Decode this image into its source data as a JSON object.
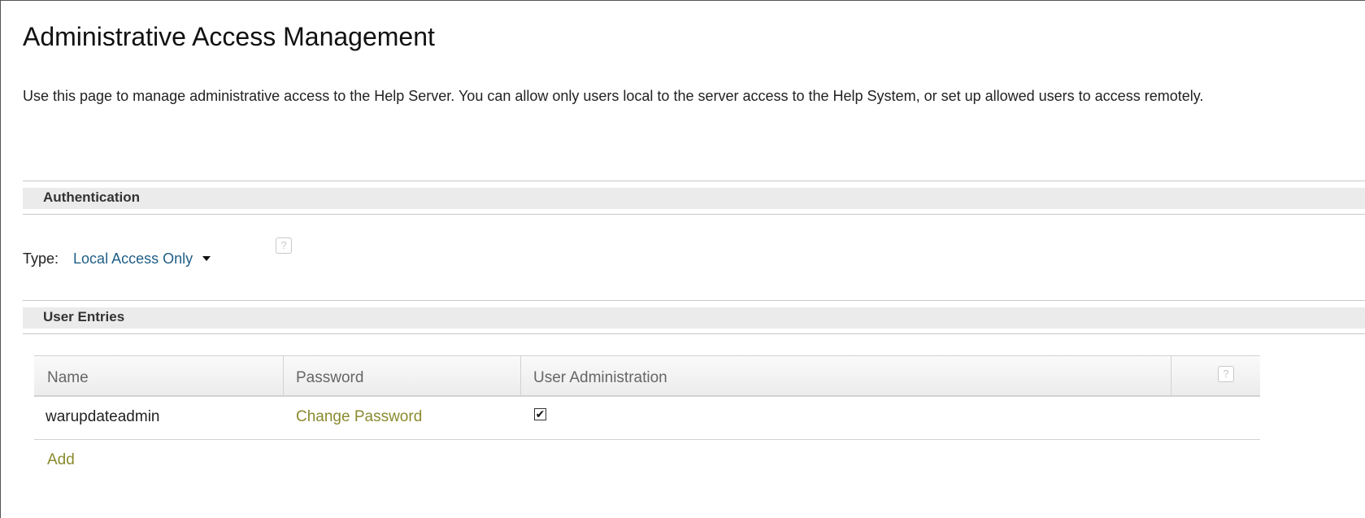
{
  "page": {
    "title": "Administrative Access Management",
    "description": "Use this page to manage administrative access to the Help Server. You can allow only users local to the server access to the Help System, or set up allowed users to access remotely."
  },
  "authentication": {
    "section_label": "Authentication",
    "type_label": "Type:",
    "type_value": "Local Access Only",
    "help_glyph": "?"
  },
  "user_entries": {
    "section_label": "User Entries",
    "columns": [
      "Name",
      "Password",
      "User Administration"
    ],
    "help_glyph": "?",
    "rows": [
      {
        "name": "warupdateadmin",
        "password_action": "Change Password",
        "user_admin_checked": true,
        "check_glyph": "✔"
      }
    ],
    "add_label": "Add"
  },
  "colors": {
    "link_blue": "#1f5e86",
    "link_olive": "#8a8a2f",
    "section_bg": "#ebebeb"
  },
  "icons": [
    "help-icon",
    "dropdown-caret-icon",
    "checkbox-checked-icon"
  ]
}
